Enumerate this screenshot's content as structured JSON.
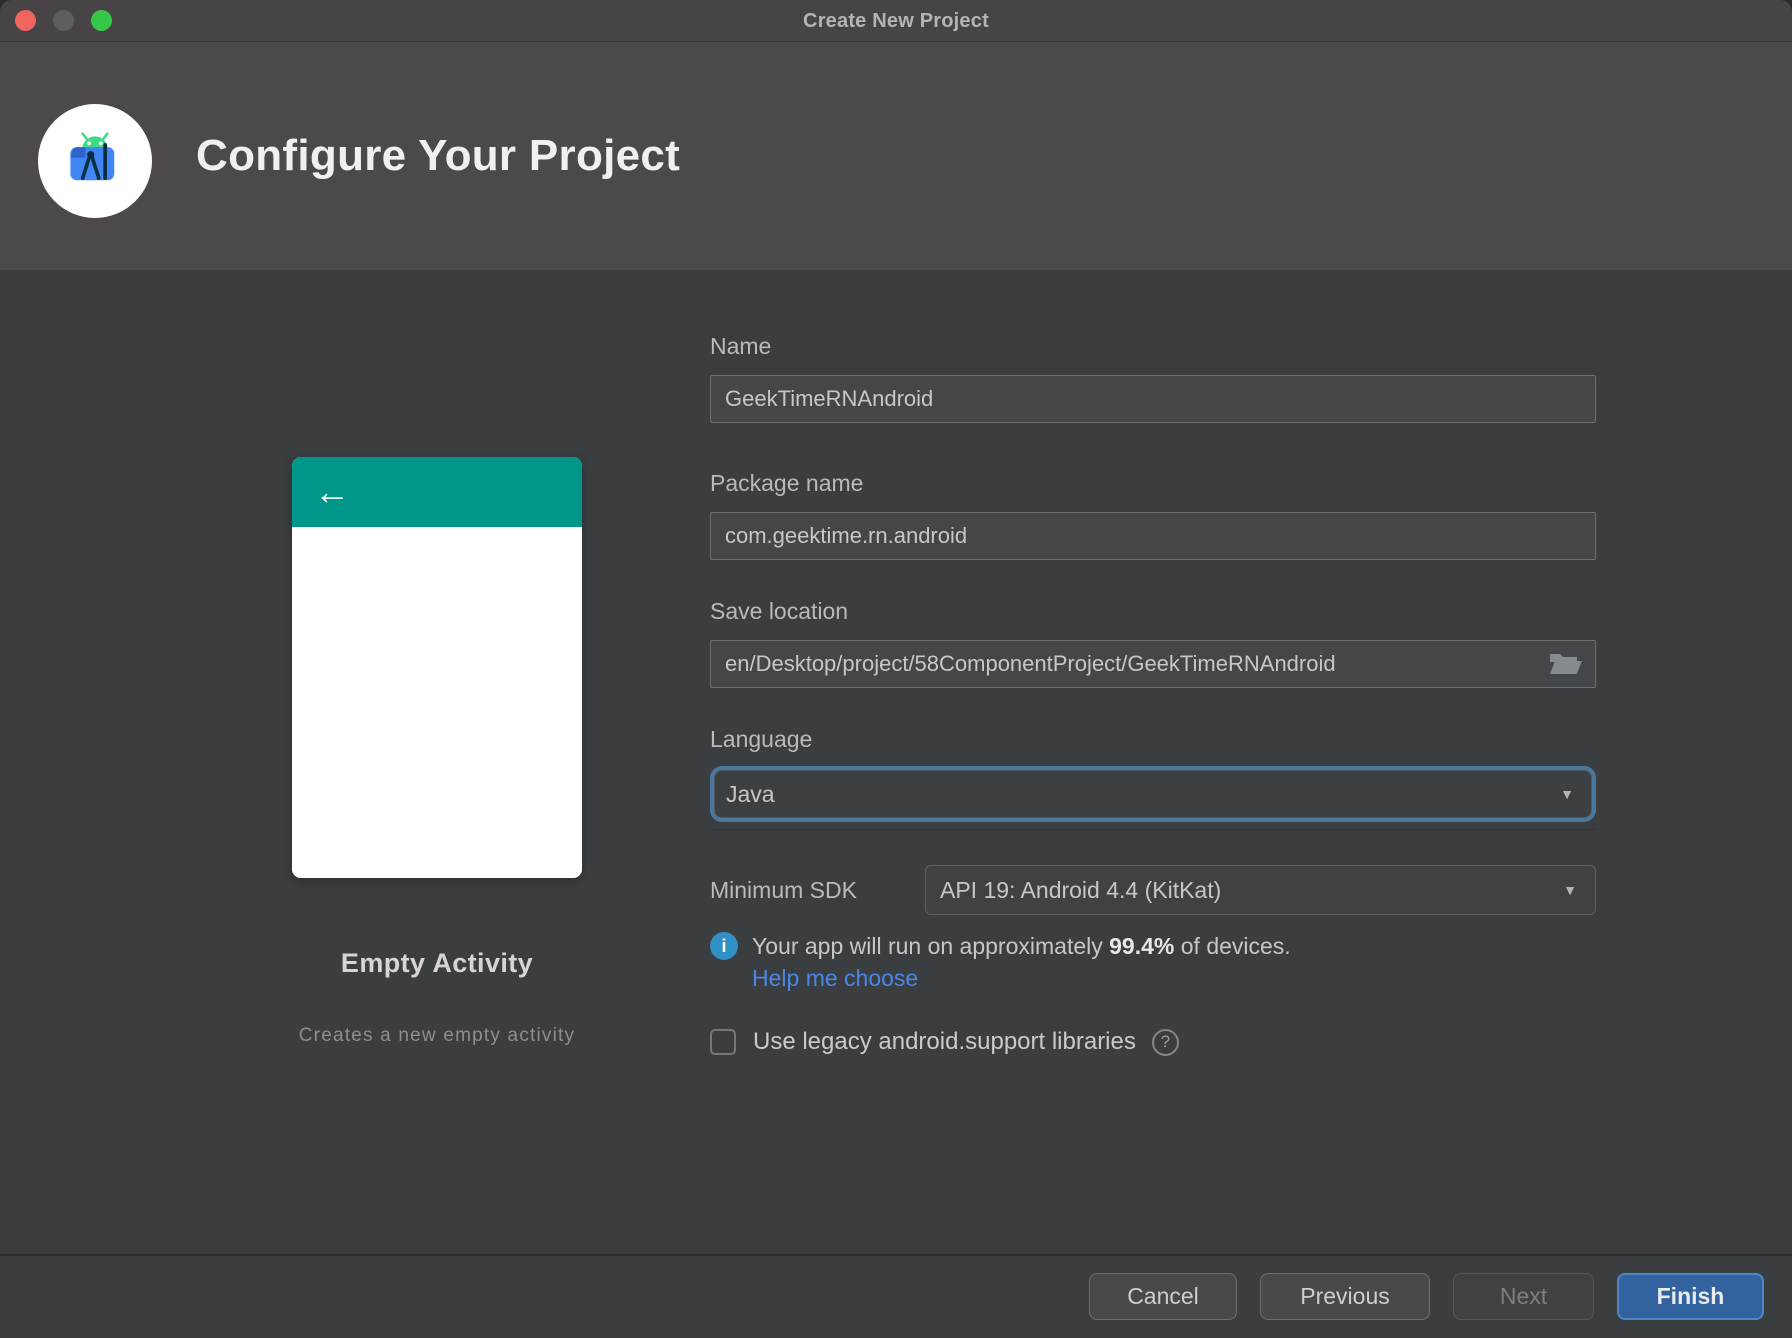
{
  "window": {
    "title": "Create New Project"
  },
  "header": {
    "title": "Configure Your Project"
  },
  "template_panel": {
    "name": "Empty Activity",
    "description": "Creates a new empty activity",
    "preview": {
      "back_icon": "←"
    }
  },
  "form": {
    "name": {
      "label": "Name",
      "value": "GeekTimeRNAndroid"
    },
    "package": {
      "label": "Package name",
      "value": "com.geektime.rn.android"
    },
    "save_location": {
      "label": "Save location",
      "value": "en/Desktop/project/58ComponentProject/GeekTimeRNAndroid"
    },
    "language": {
      "label": "Language",
      "value": "Java"
    },
    "min_sdk": {
      "label": "Minimum SDK",
      "value": "API 19: Android 4.4 (KitKat)"
    },
    "sdk_info": {
      "prefix": "Your app will run on approximately ",
      "highlight": "99.4%",
      "suffix": " of devices.",
      "icon": "i"
    },
    "help_link": "Help me choose",
    "legacy_checkbox_label": "Use legacy android.support libraries",
    "help_icon": "?",
    "dropdown_arrow": "▼"
  },
  "footer": {
    "cancel": "Cancel",
    "previous": "Previous",
    "next": "Next",
    "finish": "Finish"
  },
  "colors": {
    "appbar_teal": "#00968a",
    "finish_blue": "#33639e",
    "link_blue": "#4a86e8",
    "info_blue": "#3191c6",
    "focus_ring_blue": "#4b76a0",
    "header_gray": "#4d494b",
    "content_gray": "#3b3e41"
  }
}
